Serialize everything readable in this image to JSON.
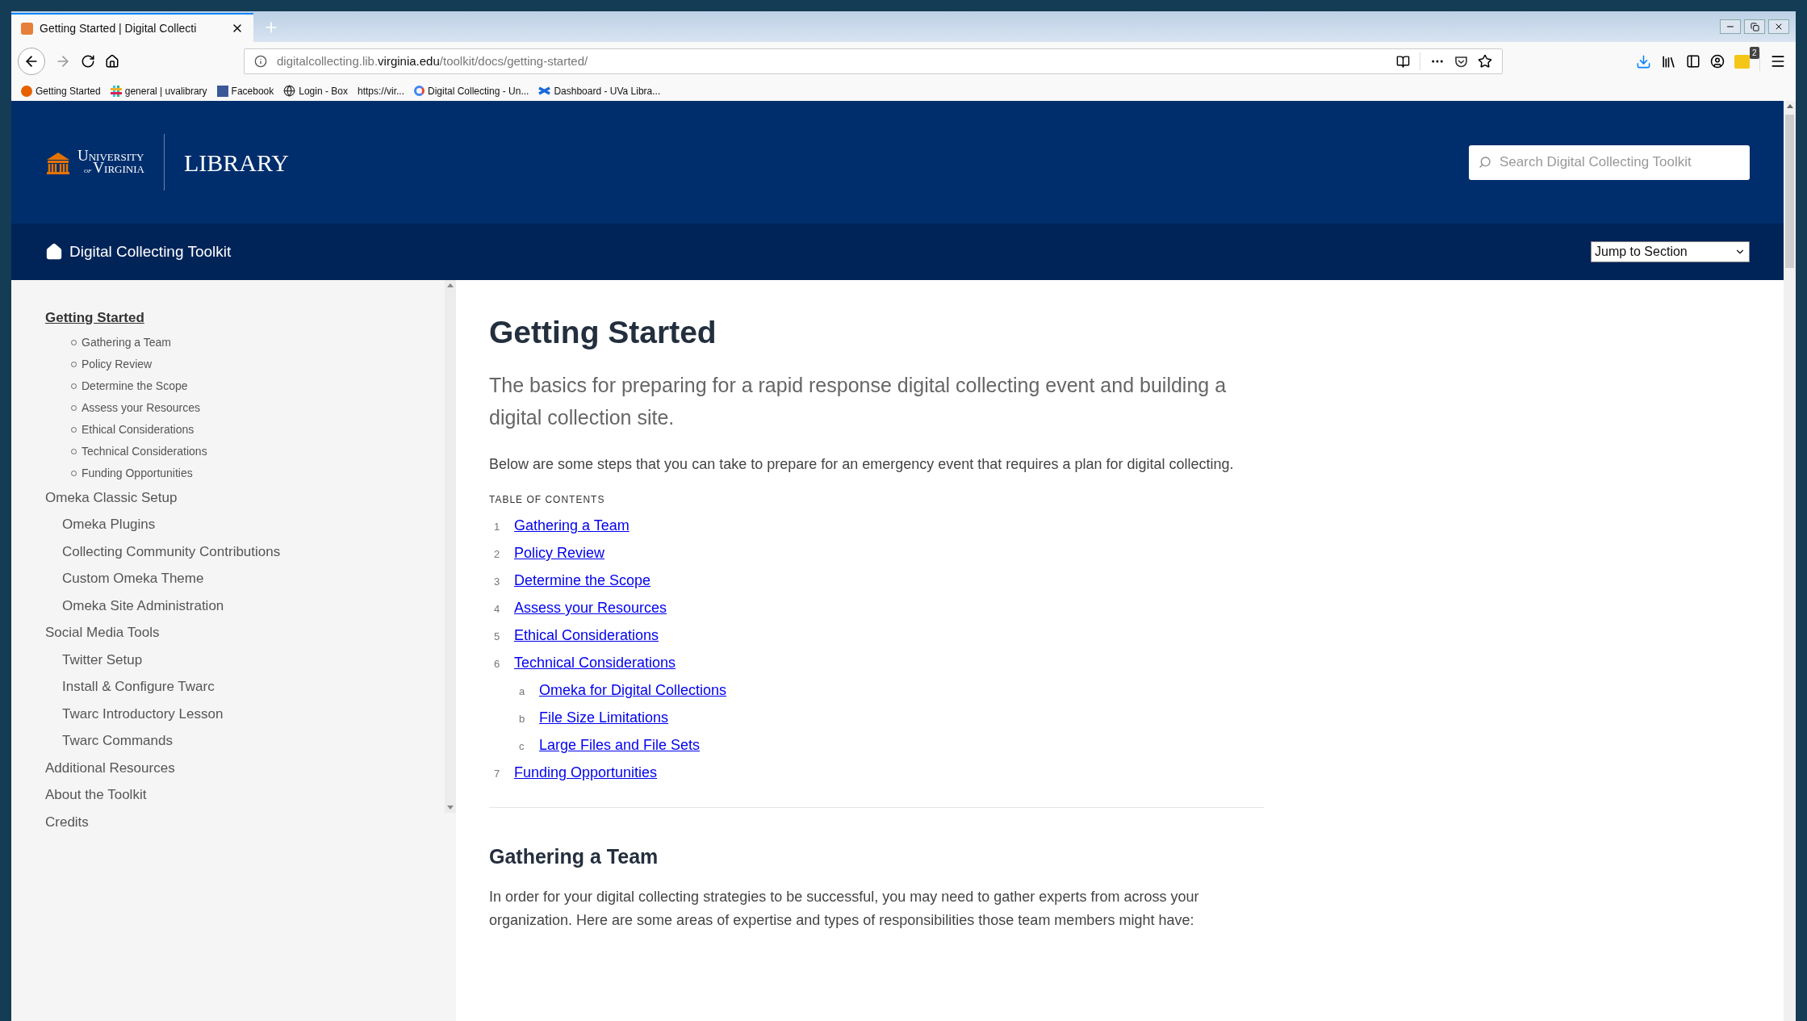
{
  "browser": {
    "tab": {
      "title": "Getting Started | Digital Collecti",
      "selected": true
    },
    "url": {
      "pre": "digitalcollecting.lib.",
      "host": "virginia.edu",
      "path": "/toolkit/docs/getting-started/"
    },
    "extension_badge": "2",
    "bookmarks": [
      {
        "label": "Getting Started",
        "kind": "firefox"
      },
      {
        "label": "general | uvalibrary",
        "kind": "slack"
      },
      {
        "label": "Facebook",
        "kind": "facebook"
      },
      {
        "label": "Login - Box",
        "kind": "globe"
      },
      {
        "label": "https://vir...",
        "kind": "none"
      },
      {
        "label": "Digital Collecting - Un...",
        "kind": "google"
      },
      {
        "label": "Dashboard - UVa Libra...",
        "kind": "confluence"
      }
    ]
  },
  "header": {
    "logo": {
      "line1": "University",
      "of": "of",
      "line2": "Virginia",
      "library": "LIBRARY"
    },
    "search": {
      "placeholder": "Search Digital Collecting Toolkit"
    }
  },
  "subnav": {
    "title": "Digital Collecting Toolkit",
    "jump": "Jump to Section"
  },
  "sidebar": {
    "items": [
      {
        "label": "Getting Started",
        "selected": true,
        "children": [
          {
            "label": "Gathering a Team",
            "kind": "anchor"
          },
          {
            "label": "Policy Review",
            "kind": "anchor"
          },
          {
            "label": "Determine the Scope",
            "kind": "anchor"
          },
          {
            "label": "Assess your Resources",
            "kind": "anchor"
          },
          {
            "label": "Ethical Considerations",
            "kind": "anchor"
          },
          {
            "label": "Technical Considerations",
            "kind": "anchor"
          },
          {
            "label": "Funding Opportunities",
            "kind": "anchor"
          }
        ]
      },
      {
        "label": "Omeka Classic Setup",
        "selected": false,
        "children": [
          {
            "label": "Omeka Plugins",
            "kind": "page"
          },
          {
            "label": "Collecting Community Contributions",
            "kind": "page"
          },
          {
            "label": "Custom Omeka Theme",
            "kind": "page"
          },
          {
            "label": "Omeka Site Administration",
            "kind": "page"
          }
        ]
      },
      {
        "label": "Social Media Tools",
        "selected": false,
        "children": [
          {
            "label": "Twitter Setup",
            "kind": "page"
          },
          {
            "label": "Install & Configure Twarc",
            "kind": "page"
          },
          {
            "label": "Twarc Introductory Lesson",
            "kind": "page"
          },
          {
            "label": "Twarc Commands",
            "kind": "page"
          }
        ]
      },
      {
        "label": "Additional Resources",
        "selected": false
      },
      {
        "label": "About the Toolkit",
        "selected": false
      },
      {
        "label": "Credits",
        "selected": false
      }
    ]
  },
  "content": {
    "title": "Getting Started",
    "lead": "The basics for preparing for a rapid response digital collecting event and building a digital collection site.",
    "intro": "Below are some steps that you can take to prepare for an emergency event that requires a plan for digital collecting.",
    "toc_heading": "TABLE OF CONTENTS",
    "toc": [
      {
        "number": "1",
        "label": "Gathering a Team"
      },
      {
        "number": "2",
        "label": "Policy Review"
      },
      {
        "number": "3",
        "label": "Determine the Scope"
      },
      {
        "number": "4",
        "label": "Assess your Resources"
      },
      {
        "number": "5",
        "label": "Ethical Considerations"
      },
      {
        "number": "6",
        "label": "Technical Considerations",
        "children": [
          {
            "number": "a",
            "label": "Omeka for Digital Collections"
          },
          {
            "number": "b",
            "label": "File Size Limitations"
          },
          {
            "number": "c",
            "label": "Large Files and File Sets"
          }
        ]
      },
      {
        "number": "7",
        "label": "Funding Opportunities"
      }
    ],
    "section_heading": "Gathering a Team",
    "section_text": "In order for your digital collecting strategies to be successful, you may need to gather experts from across your organization. Here are some areas of expertise and types of responsibilities those team members might have:"
  }
}
